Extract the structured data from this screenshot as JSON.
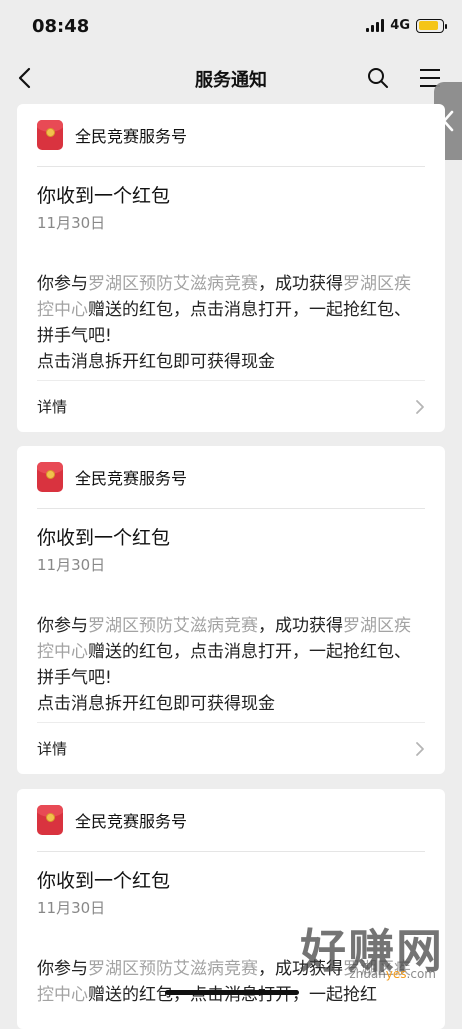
{
  "status_bar": {
    "time": "08:48",
    "network": "4G",
    "battery_level": 0.85,
    "battery_color": "#f5c518"
  },
  "nav": {
    "title": "服务通知",
    "icons": [
      "back-arrow-icon",
      "search-icon",
      "menu-icon"
    ]
  },
  "cards": [
    {
      "account": "全民竞赛服务号",
      "title": "你收到一个红包",
      "date": "11月30日",
      "body_parts": [
        "你参与",
        "罗湖区预防艾滋病竞赛",
        "，成功获得",
        "罗湖区疾控中心",
        "赠送的红包，点击消息打开，一起抢红包、拼手气吧!"
      ],
      "body_line2": "点击消息拆开红包即可获得现金",
      "footer_label": "详情"
    },
    {
      "account": "全民竞赛服务号",
      "title": "你收到一个红包",
      "date": "11月30日",
      "body_parts": [
        "你参与",
        "罗湖区预防艾滋病竞赛",
        "，成功获得",
        "罗湖区疾控中心",
        "赠送的红包，点击消息打开，一起抢红包、拼手气吧!"
      ],
      "body_line2": "点击消息拆开红包即可获得现金",
      "footer_label": "详情"
    },
    {
      "account": "全民竞赛服务号",
      "title": "你收到一个红包",
      "date": "11月30日",
      "body_parts": [
        "你参与",
        "罗湖区预防艾滋病竞赛",
        "，成功获得",
        "罗湖区疾控中心",
        "赠送的红包，点击消息打开，一起抢红"
      ],
      "body_line2": "",
      "footer_label": ""
    }
  ],
  "watermark": {
    "text": "好赚网",
    "url_prefix": "zhuan",
    "url_highlight": "yes",
    "url_suffix": ".com"
  },
  "colors": {
    "background": "#ededed",
    "card": "#ffffff",
    "highlight_text": "#a3a3a3",
    "red_packet": "#d9333f"
  }
}
